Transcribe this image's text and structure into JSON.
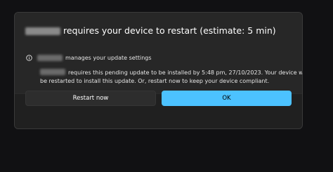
{
  "dialog": {
    "title_suffix": "requires your device to restart (estimate: 5 min)",
    "managed_text": "manages your update settings",
    "message_line1": "requires this pending update to be installed by 5:48 pm, 27/10/2023. Your device will",
    "message_line2": "be restarted to install this update. Or, restart now to keep your device compliant.",
    "info_icon": "info-circle-icon"
  },
  "buttons": {
    "restart_label": "Restart now",
    "ok_label": "OK"
  },
  "colors": {
    "accent": "#4cc2ff",
    "dialog_bg": "#272727",
    "footer_bg": "#202020"
  }
}
